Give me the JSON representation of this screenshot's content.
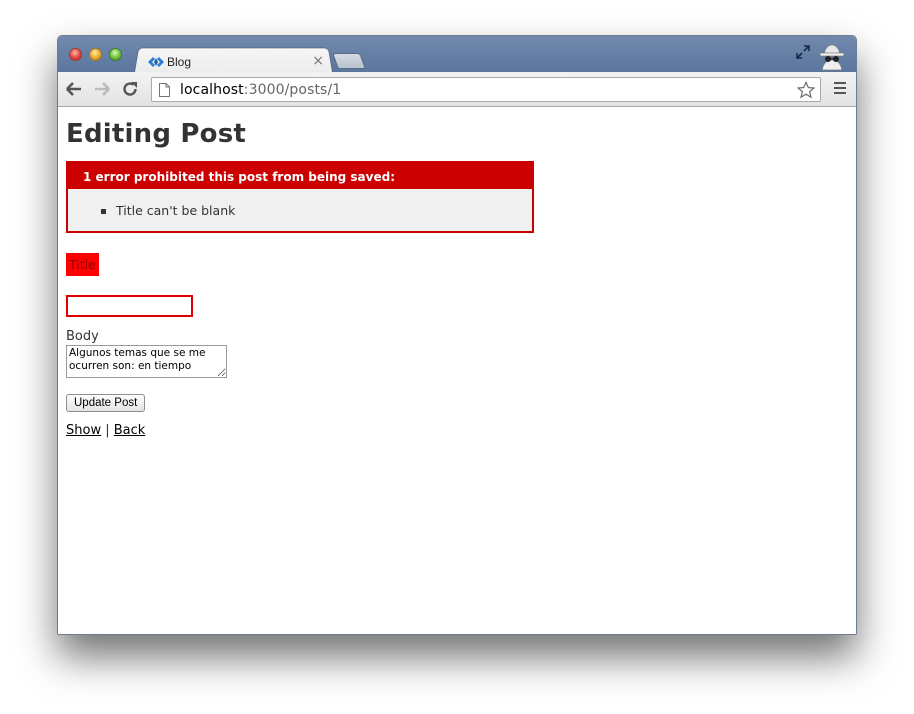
{
  "browser": {
    "tab_title": "Blog",
    "tab_close": "×",
    "url_host": "localhost",
    "url_rest": ":3000/posts/1"
  },
  "page": {
    "title": "Editing Post",
    "error_heading": "1 error prohibited this post from being saved:",
    "errors": [
      "Title can't be blank"
    ],
    "title_label": "Title",
    "title_value": "",
    "body_label": "Body",
    "body_value": "Algunos temas que se me ocurren son: en tiempo",
    "submit_label": "Update Post",
    "link_show": "Show",
    "link_separator": "|",
    "link_back": "Back"
  },
  "colors": {
    "error_red": "#cc0000",
    "field_error": "#ff0000",
    "titlebar": "#6a82a8"
  }
}
